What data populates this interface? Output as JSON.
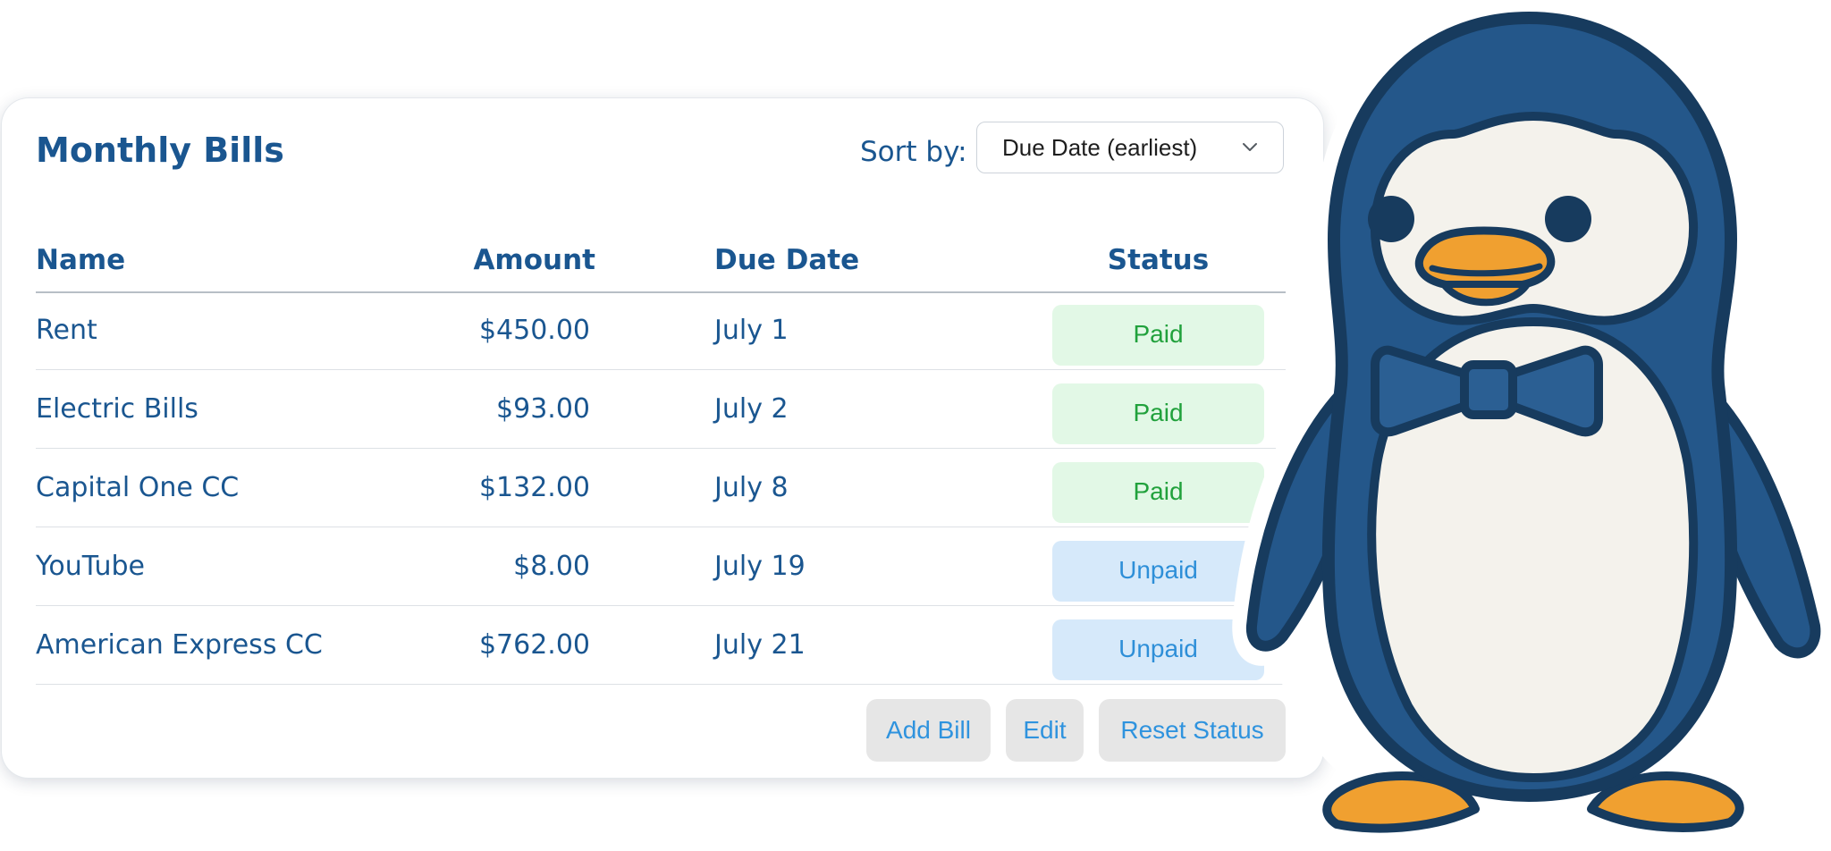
{
  "header": {
    "title": "Monthly Bills",
    "sort_label": "Sort by:",
    "sort_value": "Due Date (earliest)"
  },
  "table": {
    "columns": [
      "Name",
      "Amount",
      "Due Date",
      "Status"
    ],
    "rows": [
      {
        "name": "Rent",
        "amount": "$450.00",
        "due": "July 1",
        "status": "Paid"
      },
      {
        "name": "Electric Bills",
        "amount": "$93.00",
        "due": "July 2",
        "status": "Paid"
      },
      {
        "name": "Capital One CC",
        "amount": "$132.00",
        "due": "July 8",
        "status": "Paid"
      },
      {
        "name": "YouTube",
        "amount": "$8.00",
        "due": "July 19",
        "status": "Unpaid"
      },
      {
        "name": "American Express CC",
        "amount": "$762.00",
        "due": "July 21",
        "status": "Unpaid"
      }
    ]
  },
  "actions": {
    "add": "Add Bill",
    "edit": "Edit",
    "reset": "Reset Status"
  },
  "icons": {
    "sort_dropdown": "chevron-down-icon",
    "mascot": "penguin-mascot"
  },
  "colors": {
    "heading": "#1a5690",
    "paid_bg": "#e2f8e6",
    "paid_text": "#21a13c",
    "unpaid_bg": "#d6e9fa",
    "unpaid_text": "#2e8fd8",
    "button_bg": "#e6e6e6",
    "button_text": "#2f93de",
    "penguin_body": "#24578a",
    "penguin_outline": "#173b5e",
    "penguin_beak": "#f0a030"
  }
}
